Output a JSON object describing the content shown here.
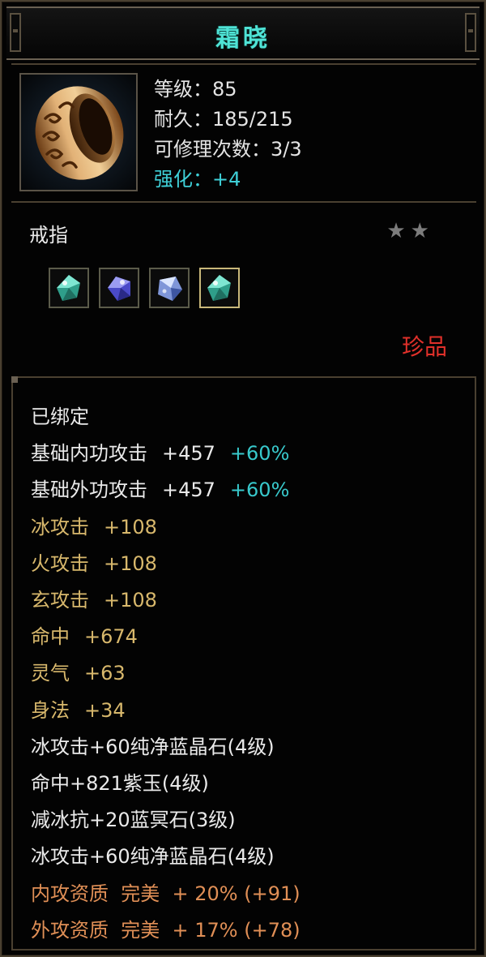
{
  "title": "霜晓",
  "header": {
    "level_label": "等级：85",
    "durability_label": "耐久：185/215",
    "repair_label": "可修理次数：3/3",
    "enhance_label": "强化：+4"
  },
  "item_type": "戒指",
  "stars_text": "★★",
  "rarity": "珍品",
  "gems": [
    {
      "name": "green-crystal",
      "color": "#3ac3a8",
      "selected": false
    },
    {
      "name": "purple-jade",
      "color": "#5b5cd8",
      "selected": false
    },
    {
      "name": "blue-stone",
      "color": "#8ea6e8",
      "selected": false
    },
    {
      "name": "green-crystal",
      "color": "#3ac3a8",
      "selected": true
    }
  ],
  "attributes": {
    "bound": "已绑定",
    "inner_attack": {
      "label": "基础内功攻击",
      "value": "+457",
      "pct": "+60%"
    },
    "outer_attack": {
      "label": "基础外功攻击",
      "value": "+457",
      "pct": "+60%"
    },
    "ice_attack": {
      "label": "冰攻击",
      "value": "+108"
    },
    "fire_attack": {
      "label": "火攻击",
      "value": "+108"
    },
    "xuan_attack": {
      "label": "玄攻击",
      "value": "+108"
    },
    "accuracy": {
      "label": "命中",
      "value": "+674"
    },
    "spirit": {
      "label": "灵气",
      "value": "+63"
    },
    "agility": {
      "label": "身法",
      "value": "+34"
    },
    "gem1": "冰攻击+60纯净蓝晶石(4级)",
    "gem2": "命中+821紫玉(4级)",
    "gem3": "减冰抗+20蓝冥石(3级)",
    "gem4": "冰攻击+60纯净蓝晶石(4级)",
    "inner_quality": "内攻资质  完美  + 20% (+91)",
    "outer_quality": "外攻资质  完美  + 17% (+78)"
  },
  "colors": {
    "title": "#4fe3d6",
    "white_text": "#eaeaea",
    "yellow_text": "#d8b86c",
    "orange_text": "#e08f56",
    "percent_cyan": "#38c9cc",
    "rarity_red": "#e0302a"
  }
}
